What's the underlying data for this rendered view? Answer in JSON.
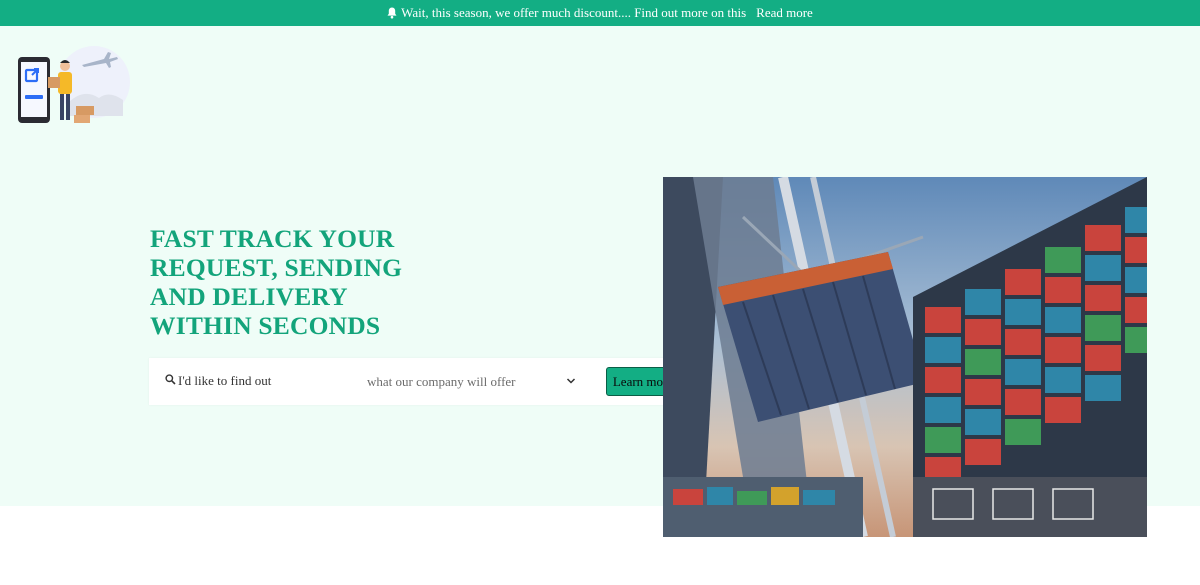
{
  "announcement": {
    "text": "Wait, this season, we offer much discount.... Find out more on this",
    "link_label": "Read more",
    "icon": "bell-icon"
  },
  "brand": {
    "logo_icon": "delivery-person-phone-plane-illustration"
  },
  "hero": {
    "headline": "FAST TRACK YOUR REQUEST, SENDING AND DELIVERY WITHIN SECONDS",
    "search": {
      "label": "I'd like to find out",
      "icon": "search-icon",
      "select_value": "what our company will offer",
      "select_icon": "chevron-down-icon"
    },
    "cta_label": "Learn more",
    "image": "container-port-crane-photo"
  },
  "colors": {
    "accent": "#13ae84",
    "headline": "#13a47b",
    "hero_bg": "#effdf7"
  }
}
